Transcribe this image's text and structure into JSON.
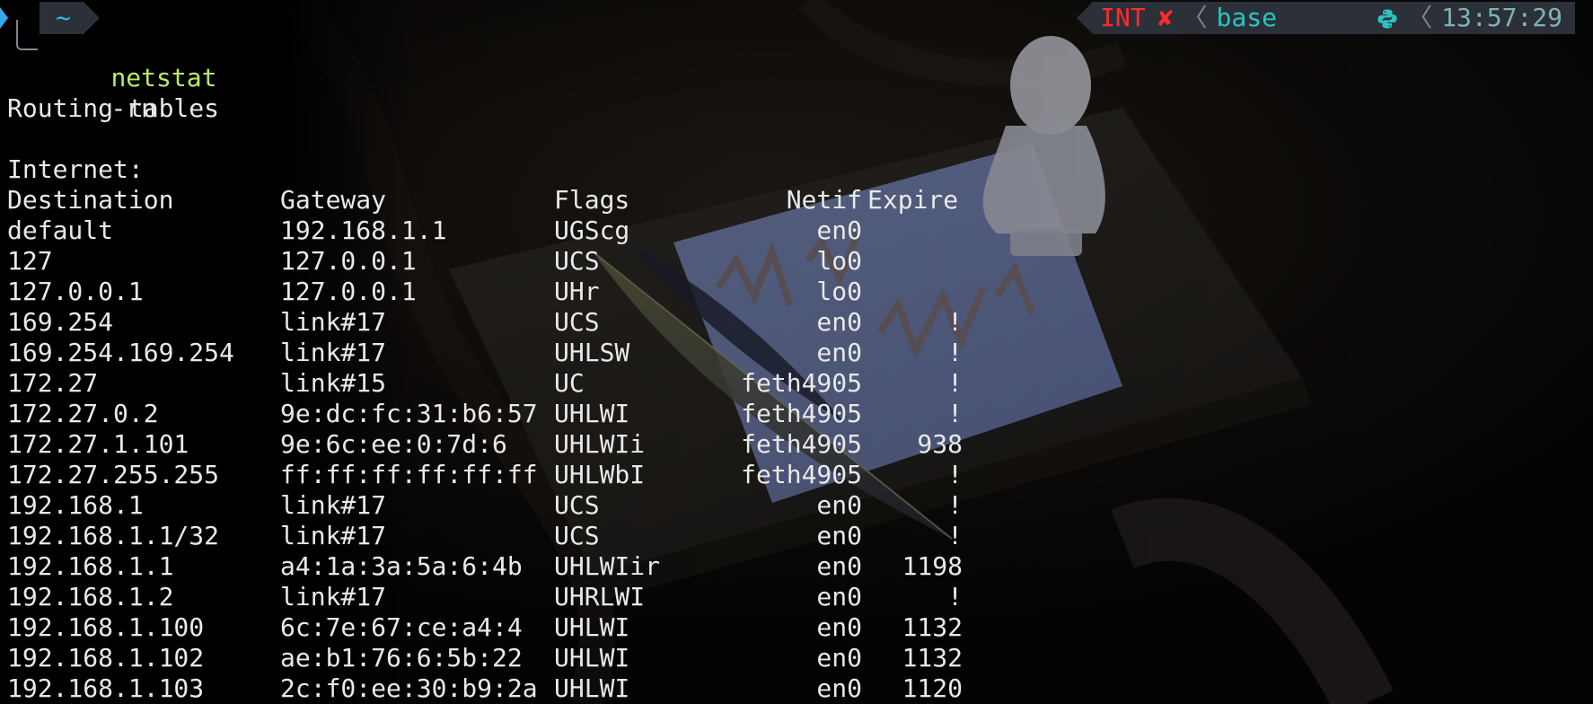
{
  "prompt": {
    "directory": "~",
    "command_name": "netstat",
    "command_args": "-rn"
  },
  "status": {
    "interrupt": "INT",
    "interrupt_mark": "✘",
    "separator": "〈",
    "env": "base",
    "env_icon": "python-icon",
    "time": "13:57:29"
  },
  "output": {
    "heading": "Routing tables",
    "section": "Internet:",
    "columns": [
      "Destination",
      "Gateway",
      "Flags",
      "Netif",
      "Expire"
    ],
    "rows": [
      [
        "default",
        "192.168.1.1",
        "UGScg",
        "en0",
        ""
      ],
      [
        "127",
        "127.0.0.1",
        "UCS",
        "lo0",
        ""
      ],
      [
        "127.0.0.1",
        "127.0.0.1",
        "UHr",
        "lo0",
        ""
      ],
      [
        "169.254",
        "link#17",
        "UCS",
        "en0",
        "!"
      ],
      [
        "169.254.169.254",
        "link#17",
        "UHLSW",
        "en0",
        "!"
      ],
      [
        "172.27",
        "link#15",
        "UC",
        "feth4905",
        "!"
      ],
      [
        "172.27.0.2",
        "9e:dc:fc:31:b6:57",
        "UHLWI",
        "feth4905",
        "!"
      ],
      [
        "172.27.1.101",
        "9e:6c:ee:0:7d:6",
        "UHLWIi",
        "feth4905",
        "938"
      ],
      [
        "172.27.255.255",
        "ff:ff:ff:ff:ff:ff",
        "UHLWbI",
        "feth4905",
        "!"
      ],
      [
        "192.168.1",
        "link#17",
        "UCS",
        "en0",
        "!"
      ],
      [
        "192.168.1.1/32",
        "link#17",
        "UCS",
        "en0",
        "!"
      ],
      [
        "192.168.1.1",
        "a4:1a:3a:5a:6:4b",
        "UHLWIir",
        "en0",
        "1198"
      ],
      [
        "192.168.1.2",
        "link#17",
        "UHRLWI",
        "en0",
        "!"
      ],
      [
        "192.168.1.100",
        "6c:7e:67:ce:a4:4",
        "UHLWI",
        "en0",
        "1132"
      ],
      [
        "192.168.1.102",
        "ae:b1:76:6:5b:22",
        "UHLWI",
        "en0",
        "1132"
      ],
      [
        "192.168.1.103",
        "2c:f0:ee:30:b9:2a",
        "UHLWI",
        "en0",
        "1120"
      ]
    ]
  },
  "colors": {
    "directory": "#2db7f5",
    "command": "#b9ea66",
    "error": "#ff2b2b",
    "env": "#2bc3c3",
    "time": "#7fb2b4",
    "text": "#e9e9e9",
    "segment_bg": "#2c3038"
  }
}
